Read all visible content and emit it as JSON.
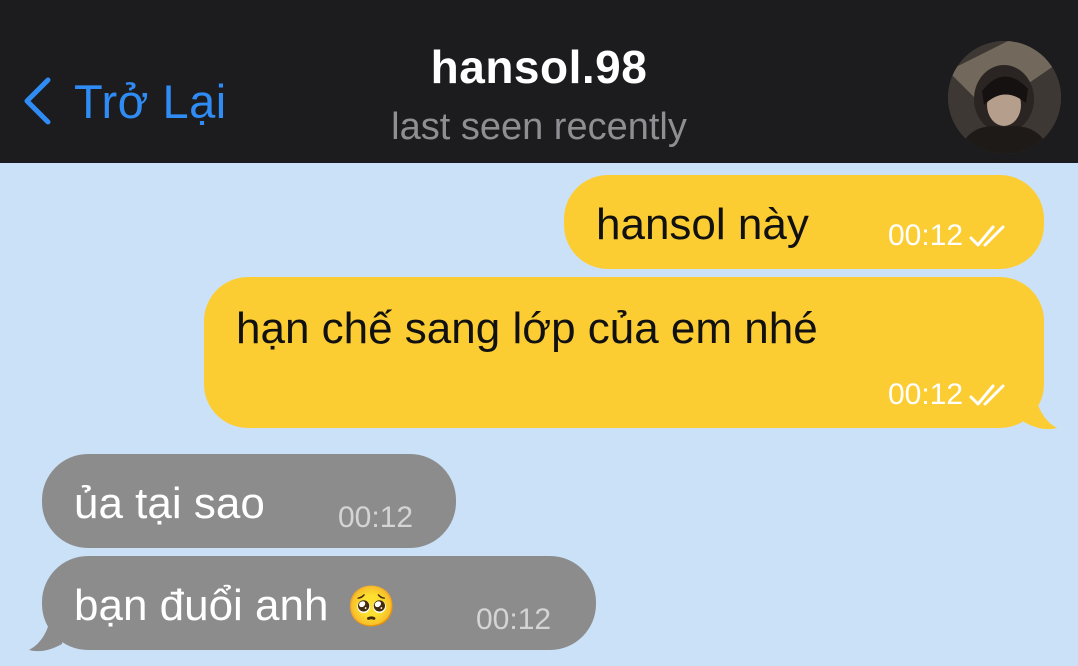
{
  "header": {
    "back_label": "Trở Lại",
    "contact_name": "hansol.98",
    "status": "last seen recently"
  },
  "colors": {
    "header_bg": "#1c1c1e",
    "chat_bg": "#cbe1f7",
    "accent": "#2f8cf5",
    "outgoing_bubble": "#fccd33",
    "incoming_bubble": "#8c8c8c"
  },
  "messages": [
    {
      "direction": "outgoing",
      "text": "hansol này",
      "time": "00:12",
      "read": true
    },
    {
      "direction": "outgoing",
      "text": "hạn chế sang lớp của em nhé",
      "time": "00:12",
      "read": true
    },
    {
      "direction": "incoming",
      "text": "ủa tại sao",
      "time": "00:12"
    },
    {
      "direction": "incoming",
      "text": "bạn đuổi anh",
      "emoji": "🥺",
      "time": "00:12"
    }
  ]
}
